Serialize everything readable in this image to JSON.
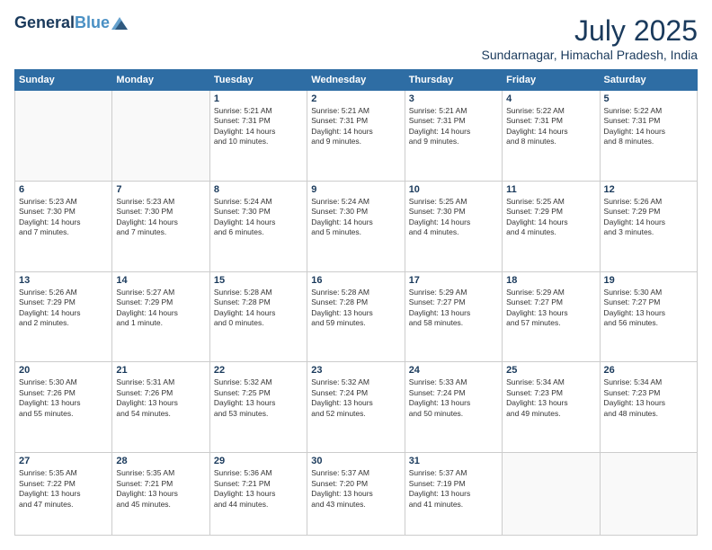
{
  "header": {
    "logo_line1": "General",
    "logo_line2": "Blue",
    "month": "July 2025",
    "location": "Sundarnagar, Himachal Pradesh, India"
  },
  "weekdays": [
    "Sunday",
    "Monday",
    "Tuesday",
    "Wednesday",
    "Thursday",
    "Friday",
    "Saturday"
  ],
  "weeks": [
    [
      {
        "day": "",
        "info": ""
      },
      {
        "day": "",
        "info": ""
      },
      {
        "day": "1",
        "info": "Sunrise: 5:21 AM\nSunset: 7:31 PM\nDaylight: 14 hours\nand 10 minutes."
      },
      {
        "day": "2",
        "info": "Sunrise: 5:21 AM\nSunset: 7:31 PM\nDaylight: 14 hours\nand 9 minutes."
      },
      {
        "day": "3",
        "info": "Sunrise: 5:21 AM\nSunset: 7:31 PM\nDaylight: 14 hours\nand 9 minutes."
      },
      {
        "day": "4",
        "info": "Sunrise: 5:22 AM\nSunset: 7:31 PM\nDaylight: 14 hours\nand 8 minutes."
      },
      {
        "day": "5",
        "info": "Sunrise: 5:22 AM\nSunset: 7:31 PM\nDaylight: 14 hours\nand 8 minutes."
      }
    ],
    [
      {
        "day": "6",
        "info": "Sunrise: 5:23 AM\nSunset: 7:30 PM\nDaylight: 14 hours\nand 7 minutes."
      },
      {
        "day": "7",
        "info": "Sunrise: 5:23 AM\nSunset: 7:30 PM\nDaylight: 14 hours\nand 7 minutes."
      },
      {
        "day": "8",
        "info": "Sunrise: 5:24 AM\nSunset: 7:30 PM\nDaylight: 14 hours\nand 6 minutes."
      },
      {
        "day": "9",
        "info": "Sunrise: 5:24 AM\nSunset: 7:30 PM\nDaylight: 14 hours\nand 5 minutes."
      },
      {
        "day": "10",
        "info": "Sunrise: 5:25 AM\nSunset: 7:30 PM\nDaylight: 14 hours\nand 4 minutes."
      },
      {
        "day": "11",
        "info": "Sunrise: 5:25 AM\nSunset: 7:29 PM\nDaylight: 14 hours\nand 4 minutes."
      },
      {
        "day": "12",
        "info": "Sunrise: 5:26 AM\nSunset: 7:29 PM\nDaylight: 14 hours\nand 3 minutes."
      }
    ],
    [
      {
        "day": "13",
        "info": "Sunrise: 5:26 AM\nSunset: 7:29 PM\nDaylight: 14 hours\nand 2 minutes."
      },
      {
        "day": "14",
        "info": "Sunrise: 5:27 AM\nSunset: 7:29 PM\nDaylight: 14 hours\nand 1 minute."
      },
      {
        "day": "15",
        "info": "Sunrise: 5:28 AM\nSunset: 7:28 PM\nDaylight: 14 hours\nand 0 minutes."
      },
      {
        "day": "16",
        "info": "Sunrise: 5:28 AM\nSunset: 7:28 PM\nDaylight: 13 hours\nand 59 minutes."
      },
      {
        "day": "17",
        "info": "Sunrise: 5:29 AM\nSunset: 7:27 PM\nDaylight: 13 hours\nand 58 minutes."
      },
      {
        "day": "18",
        "info": "Sunrise: 5:29 AM\nSunset: 7:27 PM\nDaylight: 13 hours\nand 57 minutes."
      },
      {
        "day": "19",
        "info": "Sunrise: 5:30 AM\nSunset: 7:27 PM\nDaylight: 13 hours\nand 56 minutes."
      }
    ],
    [
      {
        "day": "20",
        "info": "Sunrise: 5:30 AM\nSunset: 7:26 PM\nDaylight: 13 hours\nand 55 minutes."
      },
      {
        "day": "21",
        "info": "Sunrise: 5:31 AM\nSunset: 7:26 PM\nDaylight: 13 hours\nand 54 minutes."
      },
      {
        "day": "22",
        "info": "Sunrise: 5:32 AM\nSunset: 7:25 PM\nDaylight: 13 hours\nand 53 minutes."
      },
      {
        "day": "23",
        "info": "Sunrise: 5:32 AM\nSunset: 7:24 PM\nDaylight: 13 hours\nand 52 minutes."
      },
      {
        "day": "24",
        "info": "Sunrise: 5:33 AM\nSunset: 7:24 PM\nDaylight: 13 hours\nand 50 minutes."
      },
      {
        "day": "25",
        "info": "Sunrise: 5:34 AM\nSunset: 7:23 PM\nDaylight: 13 hours\nand 49 minutes."
      },
      {
        "day": "26",
        "info": "Sunrise: 5:34 AM\nSunset: 7:23 PM\nDaylight: 13 hours\nand 48 minutes."
      }
    ],
    [
      {
        "day": "27",
        "info": "Sunrise: 5:35 AM\nSunset: 7:22 PM\nDaylight: 13 hours\nand 47 minutes."
      },
      {
        "day": "28",
        "info": "Sunrise: 5:35 AM\nSunset: 7:21 PM\nDaylight: 13 hours\nand 45 minutes."
      },
      {
        "day": "29",
        "info": "Sunrise: 5:36 AM\nSunset: 7:21 PM\nDaylight: 13 hours\nand 44 minutes."
      },
      {
        "day": "30",
        "info": "Sunrise: 5:37 AM\nSunset: 7:20 PM\nDaylight: 13 hours\nand 43 minutes."
      },
      {
        "day": "31",
        "info": "Sunrise: 5:37 AM\nSunset: 7:19 PM\nDaylight: 13 hours\nand 41 minutes."
      },
      {
        "day": "",
        "info": ""
      },
      {
        "day": "",
        "info": ""
      }
    ]
  ]
}
